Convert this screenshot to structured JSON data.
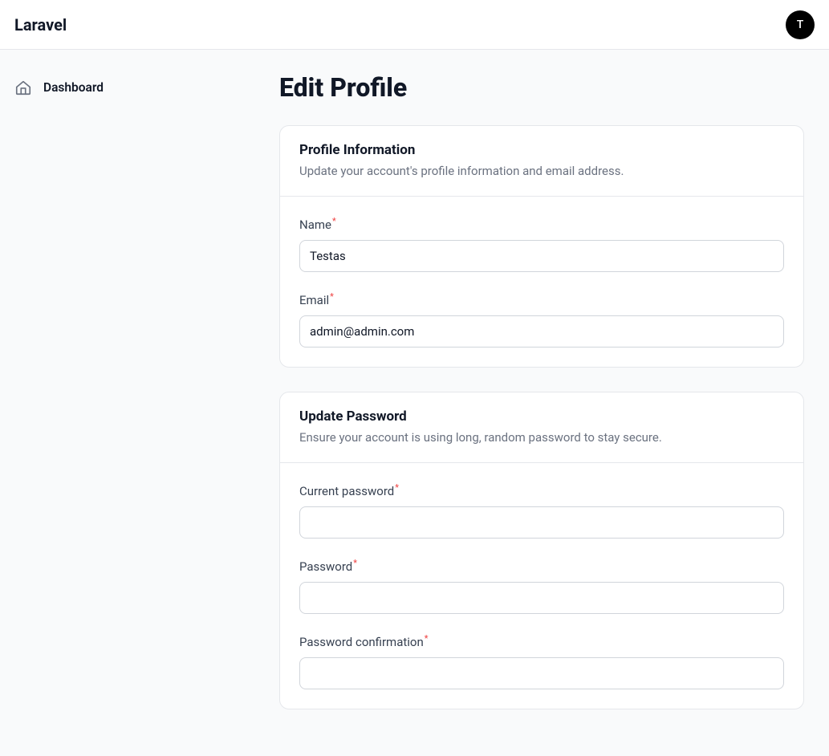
{
  "header": {
    "brand": "Laravel",
    "avatar_initial": "T"
  },
  "sidebar": {
    "items": [
      {
        "label": "Dashboard"
      }
    ]
  },
  "page": {
    "title": "Edit Profile"
  },
  "profile_section": {
    "title": "Profile Information",
    "subtitle": "Update your account's profile information and email address.",
    "fields": {
      "name": {
        "label": "Name",
        "value": "Testas"
      },
      "email": {
        "label": "Email",
        "value": "admin@admin.com"
      }
    }
  },
  "password_section": {
    "title": "Update Password",
    "subtitle": "Ensure your account is using long, random password to stay secure.",
    "fields": {
      "current_password": {
        "label": "Current password",
        "value": ""
      },
      "password": {
        "label": "Password",
        "value": ""
      },
      "password_confirmation": {
        "label": "Password confirmation",
        "value": ""
      }
    }
  },
  "required_marker": "*"
}
